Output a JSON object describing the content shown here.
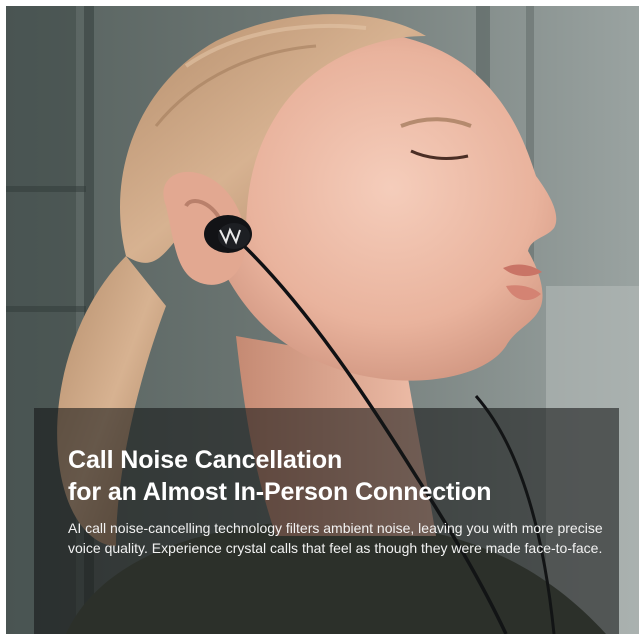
{
  "caption": {
    "headline_line1": "Call Noise Cancellation",
    "headline_line2": "for an Almost In-Person Connection",
    "body": "AI call noise-cancelling technology filters ambient noise, leaving you with more precise voice quality. Experience crystal calls that feel as though they were made face-to-face."
  },
  "colors": {
    "panel": "#141616",
    "skin": "#eab7a2",
    "hair": "#caa382",
    "earbud": "#121316",
    "background": "#5d6663"
  },
  "icons": {
    "earbud_logo": "edifier-logo-icon"
  }
}
